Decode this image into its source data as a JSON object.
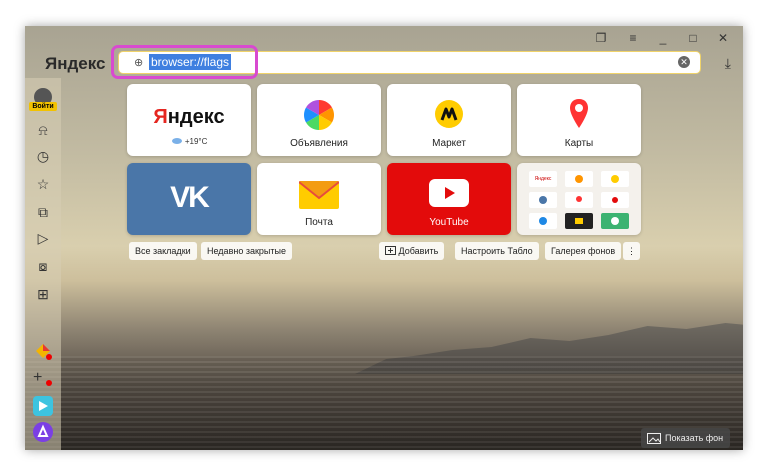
{
  "brand": "Яндекс",
  "window_controls": {
    "pin": "❐",
    "menu": "≡",
    "minimize": "_",
    "maximize": "□",
    "close": "✕"
  },
  "address_bar": {
    "url": "browser://flags",
    "globe": "⊕",
    "clear": "✕",
    "download": "⤓"
  },
  "sidebar": {
    "login_label": "Войти",
    "icons": [
      "bell-icon",
      "clock-icon",
      "star-icon",
      "collections-icon",
      "play-icon",
      "camera-icon",
      "grid-icon"
    ],
    "icon_glyphs": [
      "⍾",
      "◷",
      "☆",
      "⧉",
      "▷",
      "⧇",
      "⊞"
    ]
  },
  "tiles": [
    {
      "id": "yandex",
      "label": "",
      "logo_first": "Я",
      "logo_rest": "ндекс",
      "weather": "+19°C"
    },
    {
      "id": "obyavleniya",
      "label": "Объявления"
    },
    {
      "id": "market",
      "label": "Маркет"
    },
    {
      "id": "karty",
      "label": "Карты"
    },
    {
      "id": "vk",
      "label": "",
      "logo": "VK"
    },
    {
      "id": "pochta",
      "label": "Почта"
    },
    {
      "id": "youtube",
      "label": "YouTube"
    },
    {
      "id": "multi",
      "label": "",
      "mini_label": "Яндекс"
    }
  ],
  "chips": {
    "bookmarks": "Все закладки",
    "recent": "Недавно закрытые",
    "add": "Добавить",
    "customize": "Настроить Табло",
    "gallery": "Галерея фонов",
    "more": "⋮"
  },
  "show_bg": "Показать фон",
  "colors": {
    "accent": "#f2c200",
    "highlight": "#d84ad0",
    "vk": "#4a76a8",
    "youtube": "#e30b0b"
  }
}
